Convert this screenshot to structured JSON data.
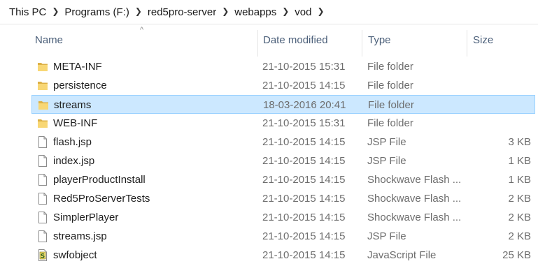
{
  "breadcrumb": [
    "This PC",
    "Programs (F:)",
    "red5pro-server",
    "webapps",
    "vod"
  ],
  "columns": {
    "name": "Name",
    "date": "Date modified",
    "type": "Type",
    "size": "Size",
    "sort_indicator": "^"
  },
  "colors": {
    "selection": "#cce8ff",
    "selection_border": "#99d1ff",
    "header_text": "#4c607a"
  },
  "files": [
    {
      "name": "META-INF",
      "date": "21-10-2015 15:31",
      "type": "File folder",
      "size": "",
      "icon": "folder-icon",
      "selected": false
    },
    {
      "name": "persistence",
      "date": "21-10-2015 14:15",
      "type": "File folder",
      "size": "",
      "icon": "folder-icon",
      "selected": false
    },
    {
      "name": "streams",
      "date": "18-03-2016 20:41",
      "type": "File folder",
      "size": "",
      "icon": "folder-icon",
      "selected": true
    },
    {
      "name": "WEB-INF",
      "date": "21-10-2015 15:31",
      "type": "File folder",
      "size": "",
      "icon": "folder-icon",
      "selected": false
    },
    {
      "name": "flash.jsp",
      "date": "21-10-2015 14:15",
      "type": "JSP File",
      "size": "3 KB",
      "icon": "file-icon",
      "selected": false
    },
    {
      "name": "index.jsp",
      "date": "21-10-2015 14:15",
      "type": "JSP File",
      "size": "1 KB",
      "icon": "file-icon",
      "selected": false
    },
    {
      "name": "playerProductInstall",
      "date": "21-10-2015 14:15",
      "type": "Shockwave Flash ...",
      "size": "1 KB",
      "icon": "file-icon",
      "selected": false
    },
    {
      "name": "Red5ProServerTests",
      "date": "21-10-2015 14:15",
      "type": "Shockwave Flash ...",
      "size": "2 KB",
      "icon": "file-icon",
      "selected": false
    },
    {
      "name": "SimplerPlayer",
      "date": "21-10-2015 14:15",
      "type": "Shockwave Flash ...",
      "size": "2 KB",
      "icon": "file-icon",
      "selected": false
    },
    {
      "name": "streams.jsp",
      "date": "21-10-2015 14:15",
      "type": "JSP File",
      "size": "2 KB",
      "icon": "file-icon",
      "selected": false
    },
    {
      "name": "swfobject",
      "date": "21-10-2015 14:15",
      "type": "JavaScript File",
      "size": "25 KB",
      "icon": "script-icon",
      "selected": false
    }
  ]
}
